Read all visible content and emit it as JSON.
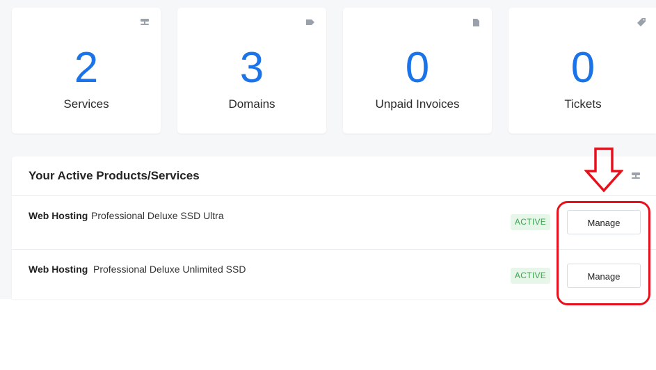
{
  "stats": [
    {
      "value": "2",
      "label": "Services",
      "icon": "server-icon"
    },
    {
      "value": "3",
      "label": "Domains",
      "icon": "tag-icon"
    },
    {
      "value": "0",
      "label": "Unpaid Invoices",
      "icon": "document-icon"
    },
    {
      "value": "0",
      "label": "Tickets",
      "icon": "ticket-icon"
    }
  ],
  "products_panel": {
    "title": "Your Active Products/Services",
    "header_icon": "server-icon",
    "rows": [
      {
        "type": "Web Hosting",
        "product": "Professional Deluxe SSD Ultra",
        "status": "ACTIVE",
        "action": "Manage"
      },
      {
        "type": "Web Hosting",
        "product": "Professional Deluxe Unlimited SSD",
        "status": "ACTIVE",
        "action": "Manage"
      }
    ]
  },
  "colors": {
    "accent": "#1a73e8",
    "status_bg": "#e6f6e8",
    "status_text": "#3fa451",
    "annotation": "#e8101c",
    "background": "#f6f7f9"
  }
}
